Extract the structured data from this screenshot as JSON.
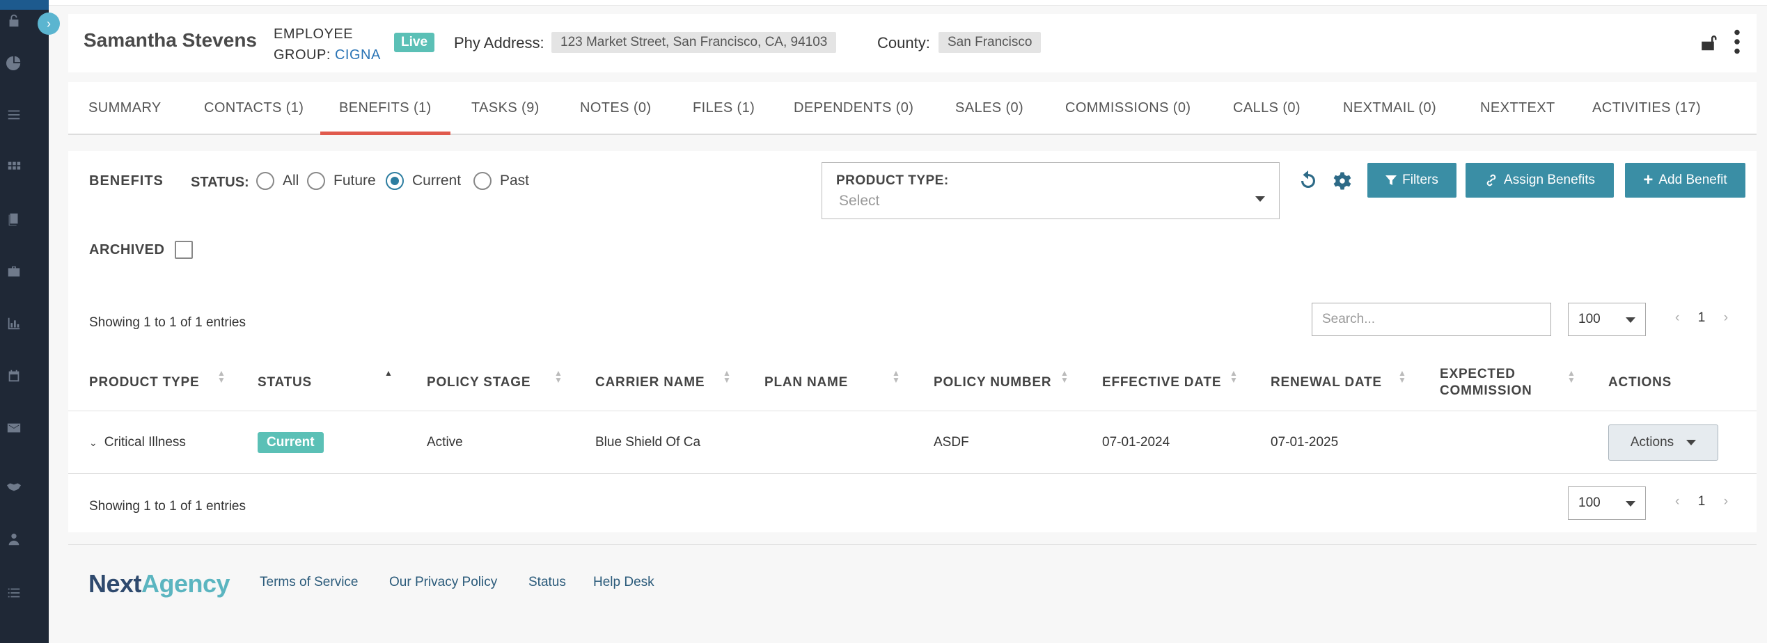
{
  "header": {
    "name": "Samantha Stevens",
    "type": "EMPLOYEE",
    "group_label": "GROUP:",
    "group_value": "CIGNA",
    "live_badge": "Live",
    "addr_label": "Phy Address:",
    "addr_value": "123 Market Street, San Francisco, CA, 94103",
    "county_label": "County:",
    "county_value": "San Francisco"
  },
  "tabs": [
    {
      "label": "SUMMARY"
    },
    {
      "label": "CONTACTS (1)"
    },
    {
      "label": "BENEFITS (1)",
      "active": true
    },
    {
      "label": "TASKS (9)"
    },
    {
      "label": "NOTES (0)"
    },
    {
      "label": "FILES (1)"
    },
    {
      "label": "DEPENDENTS (0)"
    },
    {
      "label": "SALES (0)"
    },
    {
      "label": "COMMISSIONS (0)"
    },
    {
      "label": "CALLS (0)"
    },
    {
      "label": "NEXTMAIL (0)"
    },
    {
      "label": "NEXTTEXT"
    },
    {
      "label": "ACTIVITIES (17)"
    }
  ],
  "benefits": {
    "title": "BENEFITS",
    "status_label": "STATUS:",
    "status_options": [
      "All",
      "Future",
      "Current",
      "Past"
    ],
    "status_selected": "Current",
    "product_type_label": "PRODUCT TYPE:",
    "product_type_placeholder": "Select",
    "filters_label": "Filters",
    "assign_label": "Assign Benefits",
    "add_label": "Add Benefit",
    "archived_label": "ARCHIVED",
    "archived_checked": false
  },
  "table": {
    "showing_top": "Showing 1 to 1 of 1 entries",
    "showing_bottom": "Showing 1 to 1 of 1 entries",
    "search_placeholder": "Search...",
    "page_size": "100",
    "page": "1",
    "columns": [
      "PRODUCT TYPE",
      "STATUS",
      "POLICY STAGE",
      "CARRIER NAME",
      "PLAN NAME",
      "POLICY NUMBER",
      "EFFECTIVE DATE",
      "RENEWAL DATE",
      "EXPECTED COMMISSION",
      "ACTIONS"
    ],
    "rows": [
      {
        "product_type": "Critical Illness",
        "status": "Current",
        "policy_stage": "Active",
        "carrier_name": "Blue Shield Of Ca",
        "plan_name": "",
        "policy_number": "ASDF",
        "effective_date": "07-01-2024",
        "renewal_date": "07-01-2025",
        "expected_commission": "",
        "actions_label": "Actions"
      }
    ]
  },
  "footer": {
    "logo_a": "Next",
    "logo_b": "Agency",
    "links": [
      "Terms of Service",
      "Our Privacy Policy",
      "Status",
      "Help Desk"
    ]
  },
  "colors": {
    "accent": "#3a8ea5",
    "live": "#5bc0b6",
    "active_tab": "#e05a4d",
    "sidebar": "#1f2836"
  }
}
